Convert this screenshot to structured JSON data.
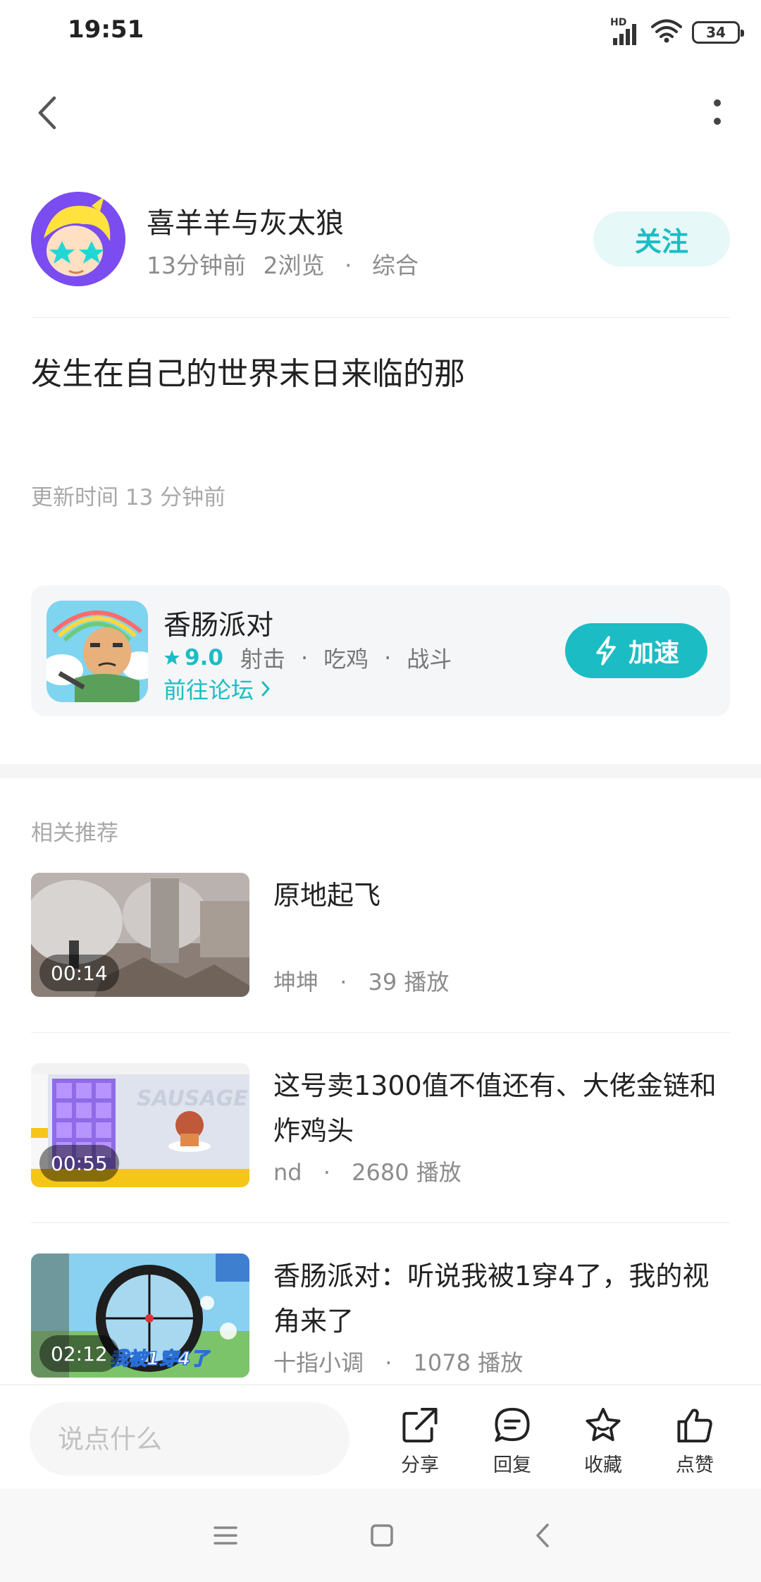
{
  "status_bar": {
    "time": "19:51",
    "network_label": "HD",
    "battery": "34"
  },
  "author": {
    "name": "喜羊羊与灰太狼",
    "time_ago": "13分钟前",
    "views": "2浏览",
    "category": "综合",
    "follow_label": "关注"
  },
  "post": {
    "title": "发生在自己的世界末日来临的那",
    "update_time": "更新时间 13 分钟前"
  },
  "game": {
    "name": "香肠派对",
    "rating": "9.0",
    "tags": [
      "射击",
      "吃鸡",
      "战斗"
    ],
    "forum_link": "前往论坛",
    "speed_label": "加速"
  },
  "related": {
    "title": "相关推荐",
    "videos": [
      {
        "title": "原地起飞",
        "author": "坤坤",
        "plays": "39 播放",
        "duration": "00:14"
      },
      {
        "title": "这号卖1300值不值还有、大佬金链和炸鸡头",
        "author": "nd",
        "plays": "2680 播放",
        "duration": "00:55",
        "thumb_overlay_text": "SAUSAGE MAN"
      },
      {
        "title": "香肠派对：听说我被1穿4了，我的视角来了",
        "author": "十指小调",
        "plays": "1078 播放",
        "duration": "02:12",
        "thumb_overlay_text": "我被1穿4了"
      }
    ]
  },
  "bottom_bar": {
    "placeholder": "说点什么",
    "share": "分享",
    "reply": "回复",
    "favorite": "收藏",
    "like": "点赞"
  },
  "colors": {
    "accent": "#1cbcc4",
    "accent_light": "#e6f8f8",
    "text": "#222222",
    "muted": "#8c8c8c"
  }
}
